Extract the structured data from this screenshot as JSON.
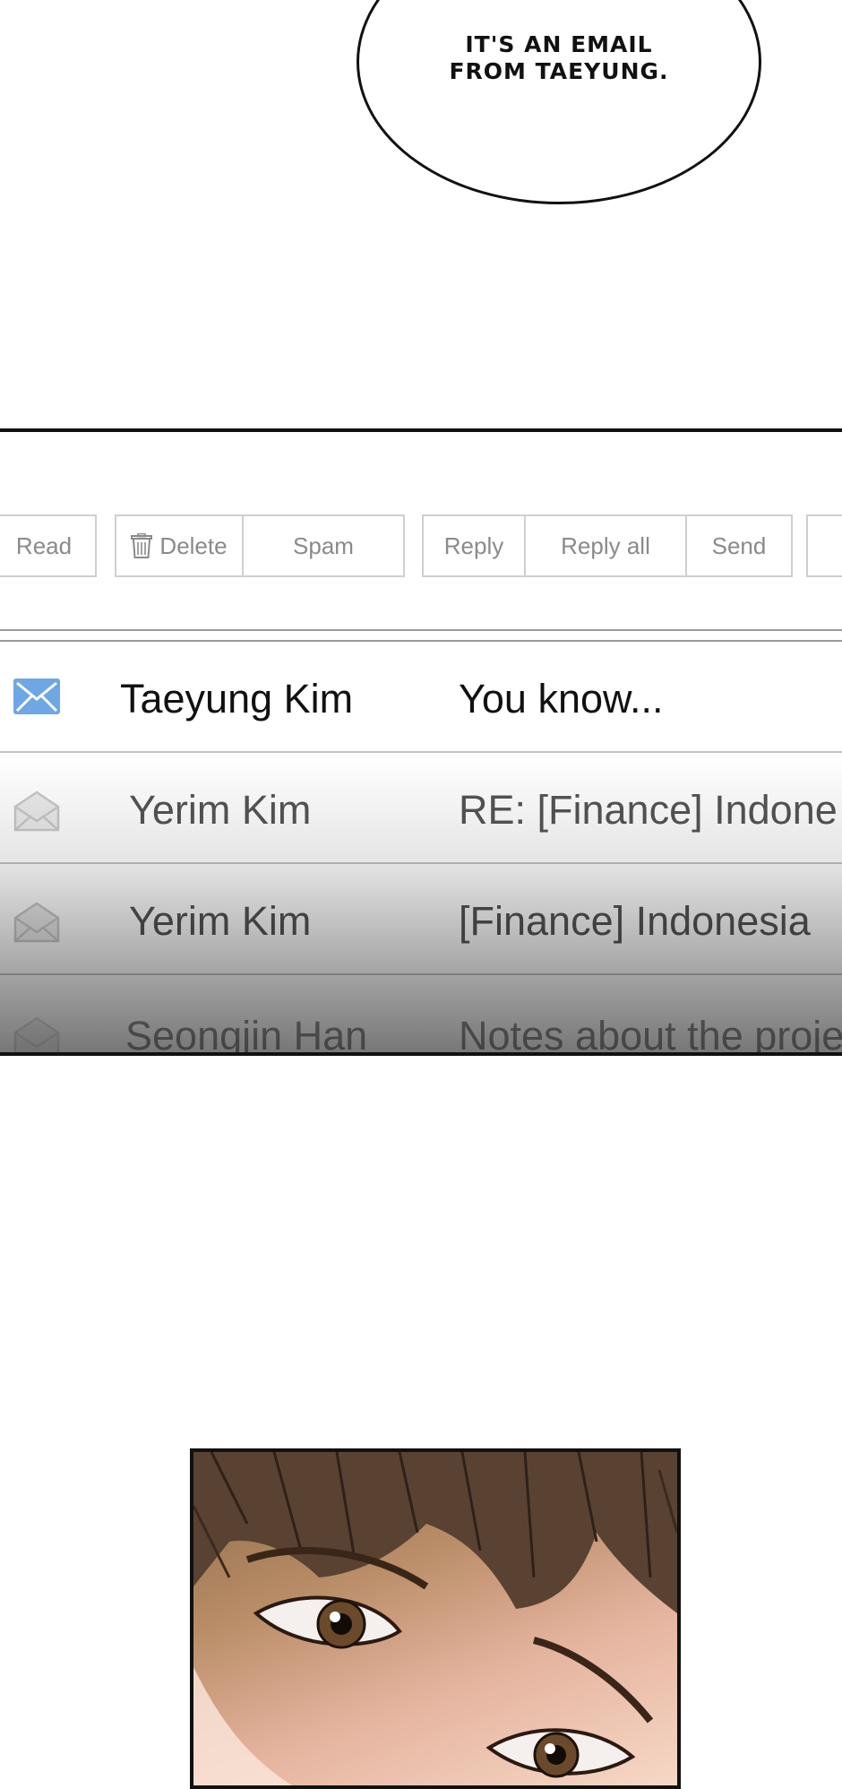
{
  "bubble": {
    "text": "IT'S AN EMAIL\nFROM TAEYUNG."
  },
  "toolbar": {
    "buttons": [
      "Read",
      "Delete",
      "Spam",
      "Reply",
      "Reply all",
      "Send"
    ]
  },
  "emails": [
    {
      "sender": "Taeyung Kim",
      "subject": "You know...",
      "unread": true,
      "icon": "envelope-closed-icon"
    },
    {
      "sender": "Yerim Kim",
      "subject": "RE: [Finance] Indone",
      "unread": false,
      "icon": "envelope-open-icon"
    },
    {
      "sender": "Yerim Kim",
      "subject": "[Finance] Indonesia",
      "unread": false,
      "icon": "envelope-open-icon"
    },
    {
      "sender": "Seongjin Han",
      "subject": "Notes about the proje",
      "unread": false,
      "icon": "envelope-open-icon"
    }
  ],
  "colors": {
    "unread_icon": "#6fa6e4",
    "read_icon": "#c8c8c8",
    "button_border": "#cfcfcf"
  }
}
